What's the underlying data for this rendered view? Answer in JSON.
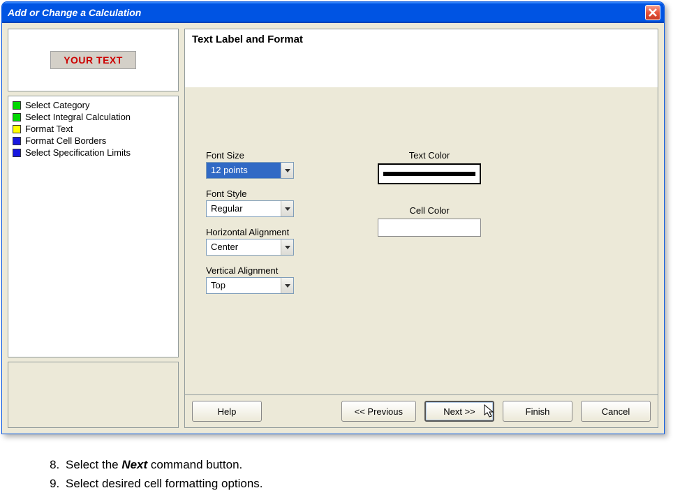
{
  "window": {
    "title": "Add or Change a Calculation"
  },
  "preview": {
    "text": "YOUR TEXT"
  },
  "steps": [
    {
      "label": "Select Category",
      "color": "#00d800"
    },
    {
      "label": "Select Integral Calculation",
      "color": "#00d800"
    },
    {
      "label": "Format Text",
      "color": "#ffff00"
    },
    {
      "label": "Format Cell Borders",
      "color": "#1818e0"
    },
    {
      "label": "Select Specification Limits",
      "color": "#1818e0"
    }
  ],
  "section_title": "Text Label and Format",
  "fields": {
    "font_size": {
      "label": "Font Size",
      "value": "12 points"
    },
    "font_style": {
      "label": "Font Style",
      "value": "Regular"
    },
    "h_align": {
      "label": "Horizontal Alignment",
      "value": "Center"
    },
    "v_align": {
      "label": "Vertical Alignment",
      "value": "Top"
    },
    "text_color": {
      "label": "Text Color",
      "value": "#000000"
    },
    "cell_color": {
      "label": "Cell Color",
      "value": "#ffffff"
    }
  },
  "buttons": {
    "help": "Help",
    "previous": "<< Previous",
    "next": "Next >>",
    "finish": "Finish",
    "cancel": "Cancel"
  },
  "instructions": [
    {
      "num": "8)",
      "text_pre": "Select the ",
      "bold": "Next",
      "text_post": " command button."
    },
    {
      "num": "9)",
      "text_pre": "Select desired cell formatting options.",
      "bold": "",
      "text_post": ""
    }
  ]
}
